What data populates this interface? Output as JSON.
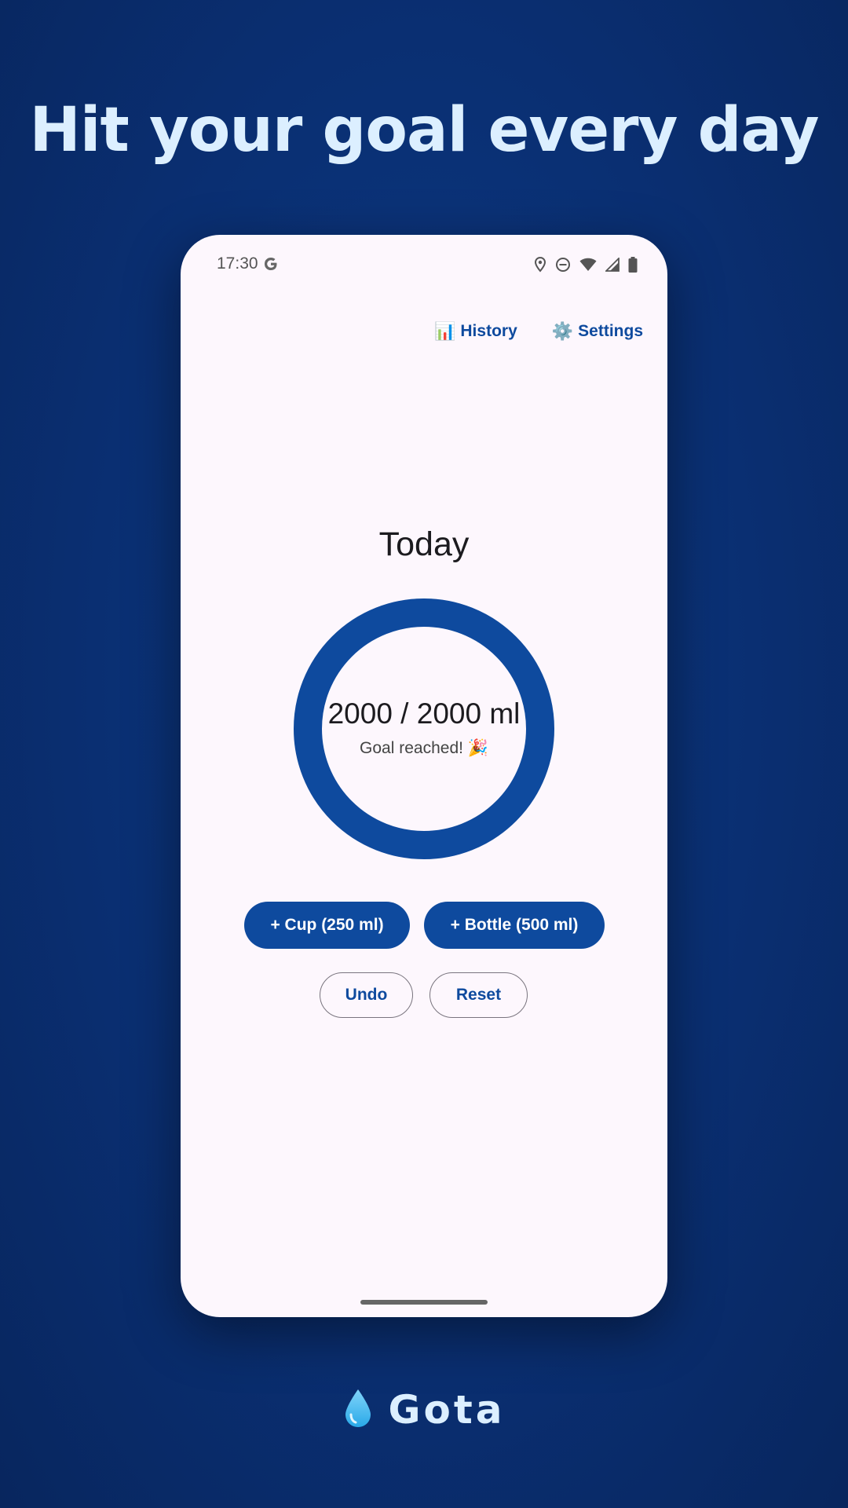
{
  "promo": {
    "headline": "Hit your goal every day",
    "brand_name": "Gota",
    "brand_icon": "water-drop-icon"
  },
  "status_bar": {
    "time": "17:30",
    "icons": [
      "google-icon",
      "location-icon",
      "do-not-disturb-icon",
      "wifi-icon",
      "signal-icon",
      "battery-icon"
    ]
  },
  "top_actions": {
    "history": {
      "emoji": "📊",
      "label": "History"
    },
    "settings": {
      "emoji": "⚙️",
      "label": "Settings"
    }
  },
  "main": {
    "title": "Today",
    "amount_text": "2000 / 2000 ml",
    "status_text": "Goal reached! 🎉",
    "progress_fraction": 1.0
  },
  "buttons": {
    "cup": "+ Cup (250 ml)",
    "bottle": "+ Bottle (500 ml)",
    "undo": "Undo",
    "reset": "Reset"
  },
  "colors": {
    "primary": "#0e4a9e",
    "background_top": "#0c3a86",
    "headline": "#dcefff",
    "screen_bg": "#fdf7fd",
    "drop": "#4fc3f7"
  }
}
